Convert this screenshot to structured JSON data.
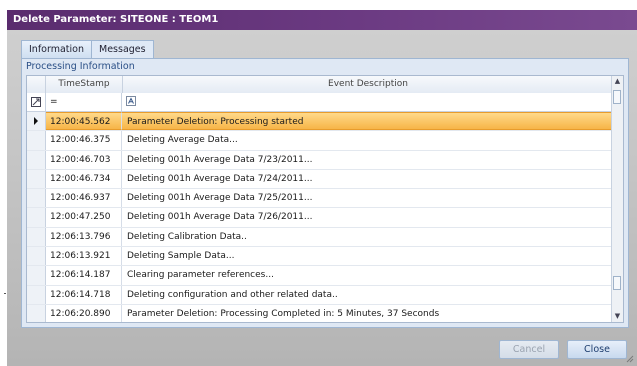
{
  "window": {
    "title": "Delete Parameter: SITEONE : TEOM1"
  },
  "tabs": [
    {
      "label": "Information",
      "active": false
    },
    {
      "label": "Messages",
      "active": true
    }
  ],
  "panel": {
    "caption": "Processing Information"
  },
  "grid": {
    "columns": [
      "TimeStamp",
      "Event Description"
    ],
    "filter": {
      "timestamp_operator": "="
    },
    "rows": [
      {
        "time": "12:00:45.562",
        "desc": "Parameter Deletion: Processing started",
        "selected": true
      },
      {
        "time": "12:00:46.375",
        "desc": "Deleting Average Data..."
      },
      {
        "time": "12:00:46.703",
        "desc": "Deleting 001h Average Data 7/23/2011..."
      },
      {
        "time": "12:00:46.734",
        "desc": "Deleting 001h Average Data 7/24/2011..."
      },
      {
        "time": "12:00:46.937",
        "desc": "Deleting 001h Average Data 7/25/2011..."
      },
      {
        "time": "12:00:47.250",
        "desc": "Deleting 001h Average Data 7/26/2011..."
      },
      {
        "time": "12:06:13.796",
        "desc": "Deleting Calibration Data.."
      },
      {
        "time": "12:06:13.921",
        "desc": "Deleting Sample Data..."
      },
      {
        "time": "12:06:14.187",
        "desc": "Clearing parameter references..."
      },
      {
        "time": "12:06:14.718",
        "desc": "Deleting configuration and other related data.."
      },
      {
        "time": "12:06:20.890",
        "desc": "Parameter Deletion: Processing Completed in: 5 Minutes, 37 Seconds"
      }
    ]
  },
  "buttons": {
    "cancel": "Cancel",
    "close": "Close"
  },
  "colors": {
    "titlebar": "#5a2c6e",
    "selected_row": "#f7b548",
    "accent": "#2a4f86"
  }
}
